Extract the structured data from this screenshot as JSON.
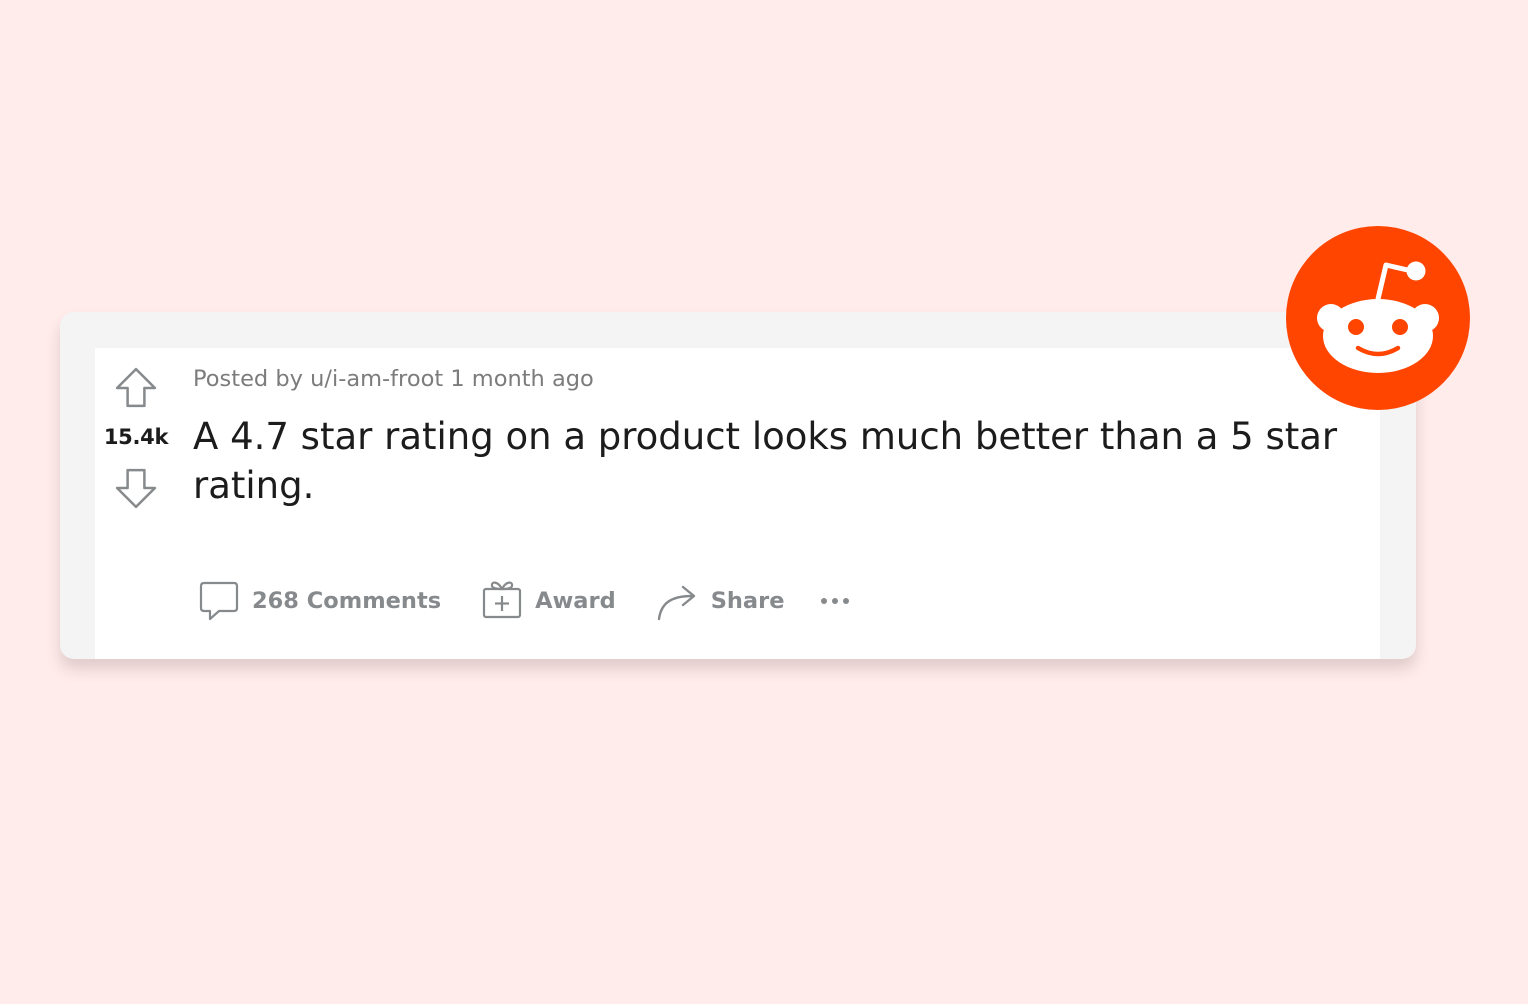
{
  "post": {
    "votes": "15.4k",
    "meta": "Posted by u/i-am-froot 1 month ago",
    "title": "A 4.7 star rating on a product looks much better than a 5 star rating."
  },
  "actions": {
    "comments": "268 Comments",
    "award": "Award",
    "share": "Share"
  },
  "icons": {
    "upvote": "arrow-up-outline-icon",
    "downvote": "arrow-down-outline-icon",
    "comments": "speech-bubble-icon",
    "award": "gift-icon",
    "share": "curved-arrow-icon",
    "more": "ellipsis-icon",
    "logo": "reddit-snoo-logo"
  },
  "colors": {
    "background": "#ffeceb",
    "brand": "#ff4500",
    "text": "#1c1c1c",
    "muted": "#878a8c"
  }
}
